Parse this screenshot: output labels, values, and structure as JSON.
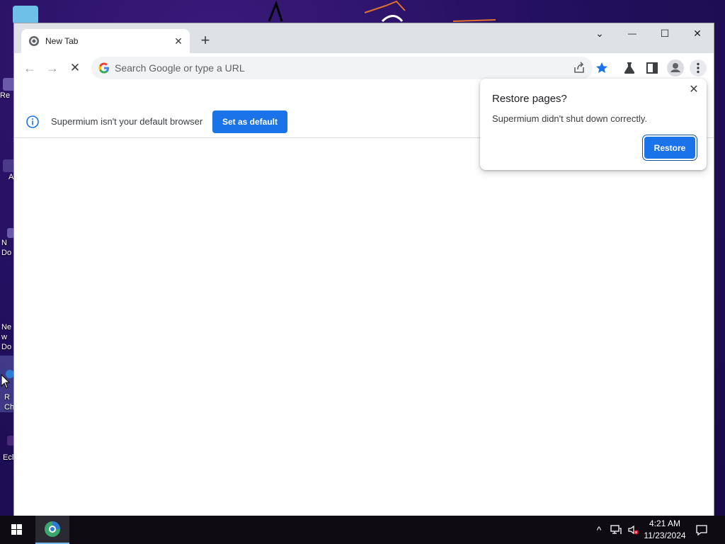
{
  "desktop": {
    "icons": [
      {
        "label": "Re"
      },
      {
        "label": "A"
      },
      {
        "label": "N Do"
      },
      {
        "label": "New Do"
      },
      {
        "label": "R Ch"
      },
      {
        "label": "Ecl"
      }
    ]
  },
  "browser": {
    "tab": {
      "title": "New Tab",
      "close_symbol": "✕"
    },
    "new_tab_symbol": "+",
    "window_controls": {
      "tab_search": "⌄",
      "minimize": "—",
      "maximize": "☐",
      "close": "✕"
    },
    "toolbar": {
      "back_icon": "←",
      "forward_icon": "→",
      "stop_icon": "✕",
      "omnibox_placeholder": "Search Google or type a URL"
    },
    "infobar": {
      "message": "Supermium isn't your default browser",
      "button_label": "Set as default"
    }
  },
  "restore_bubble": {
    "title": "Restore pages?",
    "message": "Supermium didn't shut down correctly.",
    "button_label": "Restore",
    "close_symbol": "✕"
  },
  "taskbar": {
    "time": "4:21 AM",
    "date": "11/23/2024",
    "tray_chevron": "^"
  },
  "colors": {
    "accent": "#1a73e8",
    "tabstrip": "#dee1e6",
    "taskbar": "#0e0c12"
  }
}
